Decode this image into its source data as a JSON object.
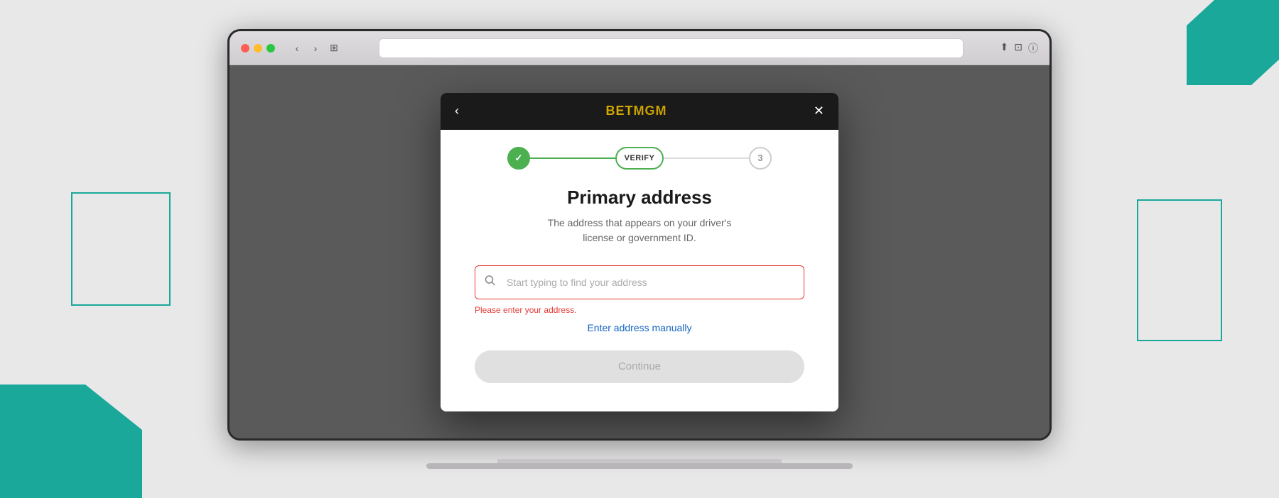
{
  "background": {
    "color": "#e8e8e8"
  },
  "browser": {
    "address_placeholder": ""
  },
  "modal": {
    "back_arrow": "‹",
    "close_icon": "✕",
    "logo_text": "BETMGM",
    "logo_bet": "BET",
    "logo_mgm": "MGM"
  },
  "stepper": {
    "step1_done": "✓",
    "step2_label": "VERIFY",
    "step3_label": "3",
    "line1_color": "#4caf50",
    "line2_color": "#ddd"
  },
  "form": {
    "title": "Primary address",
    "subtitle_line1": "The address that appears on your driver's",
    "subtitle_line2": "license or government ID.",
    "input_placeholder": "Start typing to find your address",
    "error_message": "Please enter your address.",
    "manual_link": "Enter address manually",
    "continue_button": "Continue"
  }
}
